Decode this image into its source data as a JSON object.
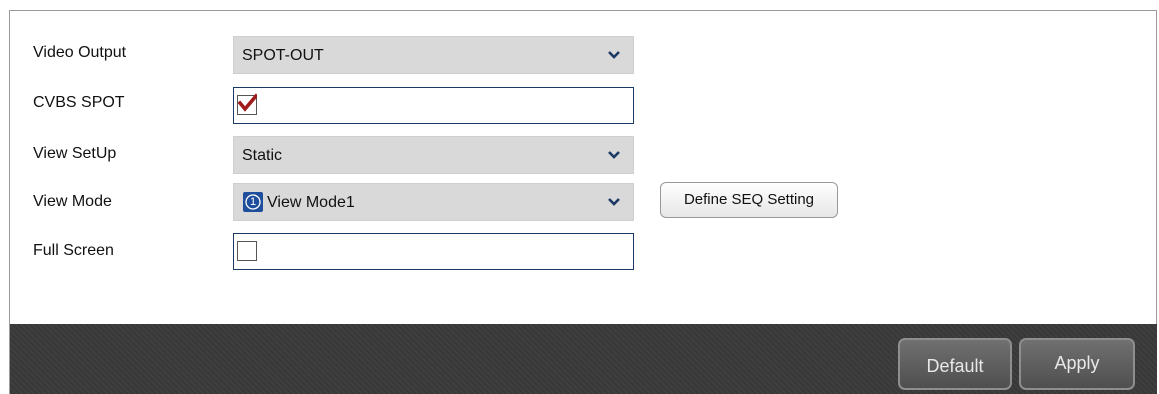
{
  "form": {
    "video_output": {
      "label": "Video Output",
      "value": "SPOT-OUT"
    },
    "cvbs_spot": {
      "label": "CVBS SPOT",
      "checked": true
    },
    "view_setup": {
      "label": "View SetUp",
      "value": "Static"
    },
    "view_mode": {
      "label": "View Mode",
      "badge": "1",
      "value": "View Mode1"
    },
    "full_screen": {
      "label": "Full Screen",
      "checked": false
    }
  },
  "define_seq_button": "Define SEQ Setting",
  "footer": {
    "default_label": "Default",
    "apply_label": "Apply"
  },
  "colors": {
    "select_bg": "#d9d9d9",
    "checkbox_border": "#1c3a66",
    "checkmark": "#a01c1c",
    "chevron": "#1c3a66",
    "mode_badge": "#1e4e9c",
    "footer_bg": "#3a3a3a"
  }
}
